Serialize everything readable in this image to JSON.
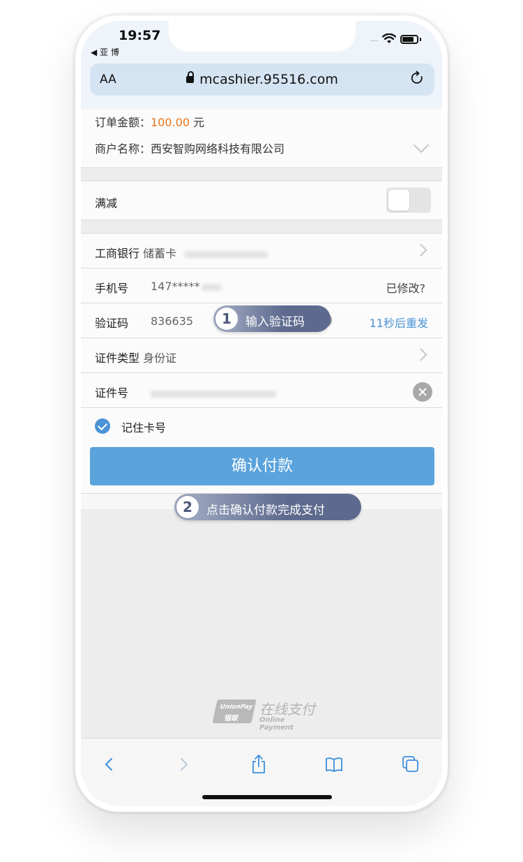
{
  "status": {
    "time": "19:57",
    "back_app": "◀ 亚 博",
    "signal": "....."
  },
  "browser": {
    "text_size": "AA",
    "url": "mcashier.95516.com"
  },
  "order": {
    "amount_label": "订单金额：",
    "amount_value": "100.00",
    "amount_unit": " 元",
    "merchant_label": "商户名称：",
    "merchant_value": "西安智购网络科技有限公司"
  },
  "discount": {
    "label": "满减"
  },
  "card": {
    "bank": "工商银行",
    "type": "储蓄卡"
  },
  "phone": {
    "label": "手机号",
    "value": "147*****",
    "action": "已修改?"
  },
  "code": {
    "label": "验证码",
    "value": "836635",
    "resend": "11秒后重发"
  },
  "id_type": {
    "label": "证件类型",
    "value": "身份证"
  },
  "id_number": {
    "label": "证件号"
  },
  "remember": {
    "label": "记住卡号"
  },
  "pay_button": {
    "label": "确认付款"
  },
  "callouts": [
    {
      "num": "1",
      "text": "输入验证码"
    },
    {
      "num": "2",
      "text": "点击确认付款完成支付"
    }
  ],
  "logo": {
    "box_top": "UnionPay",
    "box_bottom": "银联",
    "cn": "在线支付",
    "en": "Online Payment"
  },
  "toolbar": [
    "back-icon",
    "forward-icon",
    "share-icon",
    "bookmarks-icon",
    "tabs-icon"
  ],
  "colors": {
    "accent": "#5aa3dc",
    "amount": "#e8741c",
    "link": "#4a93d6"
  }
}
